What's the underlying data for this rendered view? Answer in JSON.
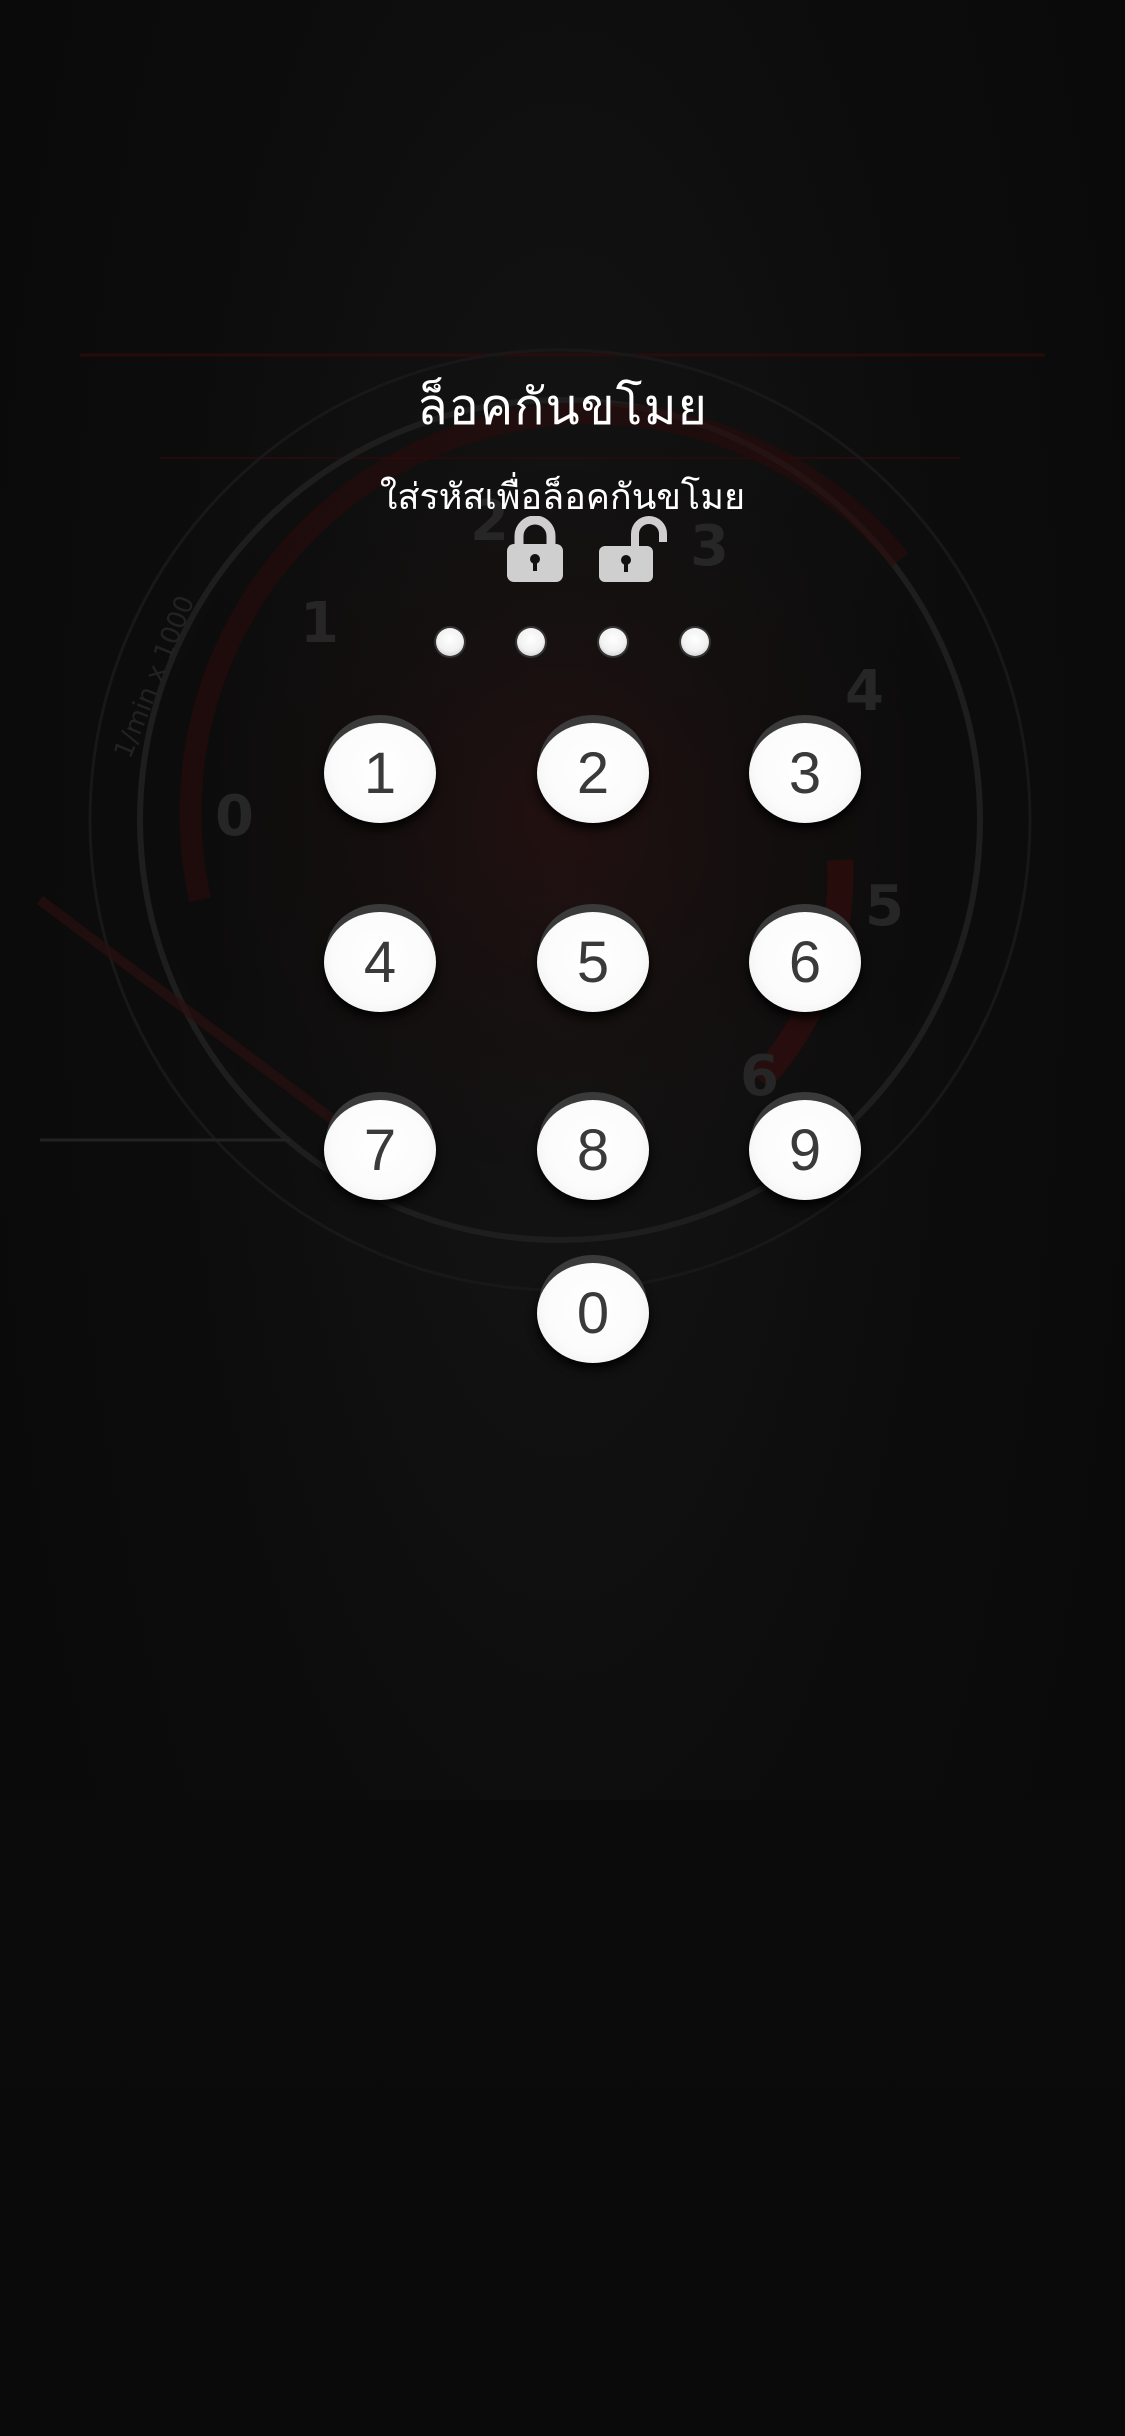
{
  "screen": {
    "title": "ล็อคกันขโมย",
    "subtitle": "ใส่รหัสเพื่อล็อคกันขโมย"
  },
  "icons": {
    "locked": "lock-closed-icon",
    "unlocked": "lock-open-icon"
  },
  "pin": {
    "length": 4,
    "entered": 0
  },
  "keypad": {
    "keys": [
      "1",
      "2",
      "3",
      "4",
      "5",
      "6",
      "7",
      "8",
      "9",
      "0"
    ]
  },
  "background": {
    "gauge_numbers": [
      "0",
      "1",
      "2",
      "3",
      "4",
      "5",
      "6"
    ],
    "gauge_unit_label": "1/min x 1000"
  },
  "colors": {
    "background": "#0d0d0d",
    "key_face": "#ffffff",
    "key_text": "#3a3a3a",
    "icon_gray": "#cfcfcf",
    "text": "#ffffff"
  }
}
